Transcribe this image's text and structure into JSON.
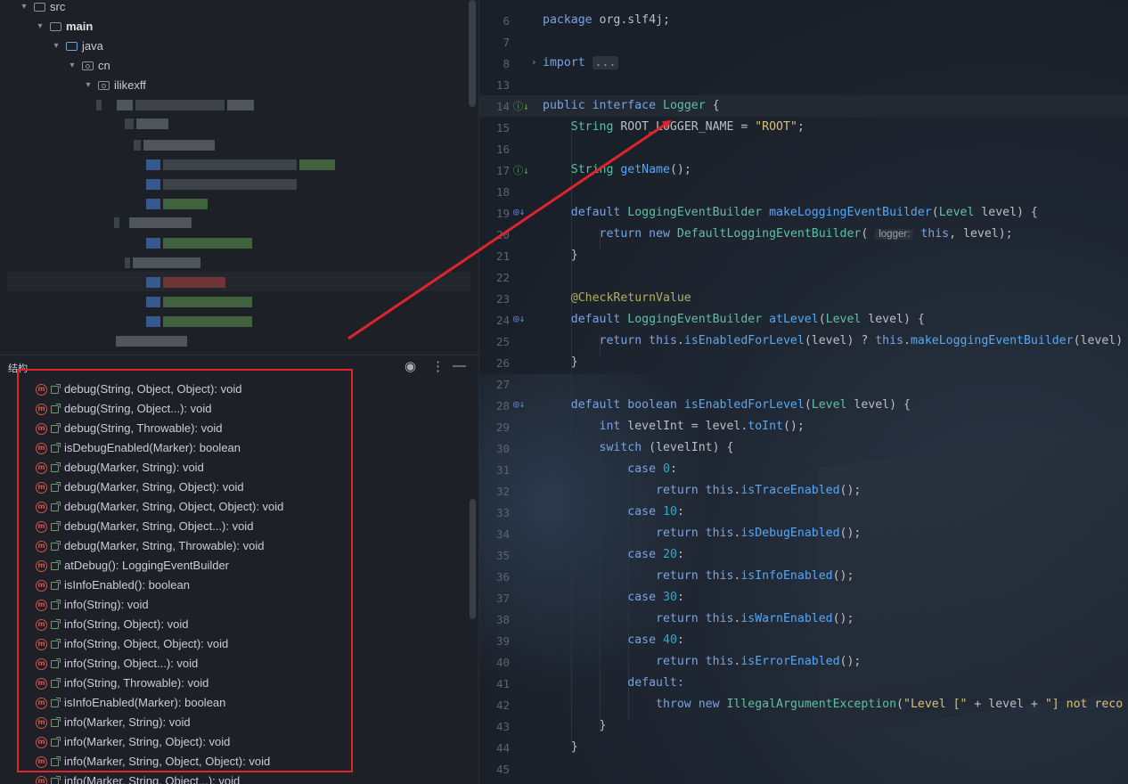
{
  "project_tree": {
    "items": [
      {
        "label": "src",
        "indent": 0
      },
      {
        "label": "main",
        "indent": 1
      },
      {
        "label": "java",
        "indent": 2
      },
      {
        "label": "cn",
        "indent": 3
      },
      {
        "label": "ilikexff",
        "indent": 4
      }
    ]
  },
  "structure_panel": {
    "title": "结构",
    "icons": {
      "view": "eye-icon",
      "more": "more-vertical-icon",
      "minimize": "minimize-icon"
    },
    "methods": [
      "debug(String, Object, Object): void",
      "debug(String, Object...): void",
      "debug(String, Throwable): void",
      "isDebugEnabled(Marker): boolean",
      "debug(Marker, String): void",
      "debug(Marker, String, Object): void",
      "debug(Marker, String, Object, Object): void",
      "debug(Marker, String, Object...): void",
      "debug(Marker, String, Throwable): void",
      "atDebug(): LoggingEventBuilder",
      "isInfoEnabled(): boolean",
      "info(String): void",
      "info(String, Object): void",
      "info(String, Object, Object): void",
      "info(String, Object...): void",
      "info(String, Throwable): void",
      "isInfoEnabled(Marker): boolean",
      "info(Marker, String): void",
      "info(Marker, String, Object): void",
      "info(Marker, String, Object, Object): void",
      "info(Marker, String, Object...): void"
    ]
  },
  "editor": {
    "line_numbers": [
      "6",
      "7",
      "8",
      "13",
      "14",
      "15",
      "16",
      "17",
      "18",
      "19",
      "20",
      "21",
      "22",
      "23",
      "24",
      "25",
      "26",
      "27",
      "28",
      "29",
      "30",
      "31",
      "32",
      "33",
      "34",
      "35",
      "36",
      "37",
      "38",
      "39",
      "40",
      "41",
      "42",
      "43",
      "44",
      "45"
    ],
    "fold_placeholder": "...",
    "inlay_hint": "logger:",
    "code": {
      "package_kw": "package",
      "package_name": "org.slf4j;",
      "import_kw": "import",
      "public_kw": "public",
      "interface_kw": "interface",
      "interface_name": "Logger",
      "brace_open": "{",
      "root_type": "String",
      "root_const": "ROOT_LOGGER_NAME",
      "root_value": "\"ROOT\"",
      "getname_type": "String",
      "getname_fn": "getName",
      "default_kw": "default",
      "leb_type": "LoggingEventBuilder",
      "make_fn": "makeLoggingEventBuilder",
      "level_type": "Level",
      "return_kw": "return",
      "new_kw": "new",
      "dleb_type": "DefaultLoggingEventBuilder",
      "annotation": "@CheckReturnValue",
      "atlevel_fn": "atLevel",
      "this_kw": "this",
      "isenabledforlevel_fn": "isEnabledForLevel",
      "boolean_kw": "boolean",
      "int_kw": "int",
      "toint_fn": "toInt",
      "switch_kw": "switch",
      "case_kw": "case",
      "default_label": "default:",
      "throw_kw": "throw",
      "iae_type": "IllegalArgumentException",
      "level_str": "\"Level [\"",
      "not_reco_str": "\"] not reco",
      "cases": [
        {
          "num": "0",
          "fn": "isTraceEnabled"
        },
        {
          "num": "10",
          "fn": "isDebugEnabled"
        },
        {
          "num": "20",
          "fn": "isInfoEnabled"
        },
        {
          "num": "30",
          "fn": "isWarnEnabled"
        },
        {
          "num": "40",
          "fn": "isErrorEnabled"
        }
      ]
    }
  },
  "colors": {
    "highlight_box": "#e0242b",
    "arrow": "#e0242b"
  }
}
